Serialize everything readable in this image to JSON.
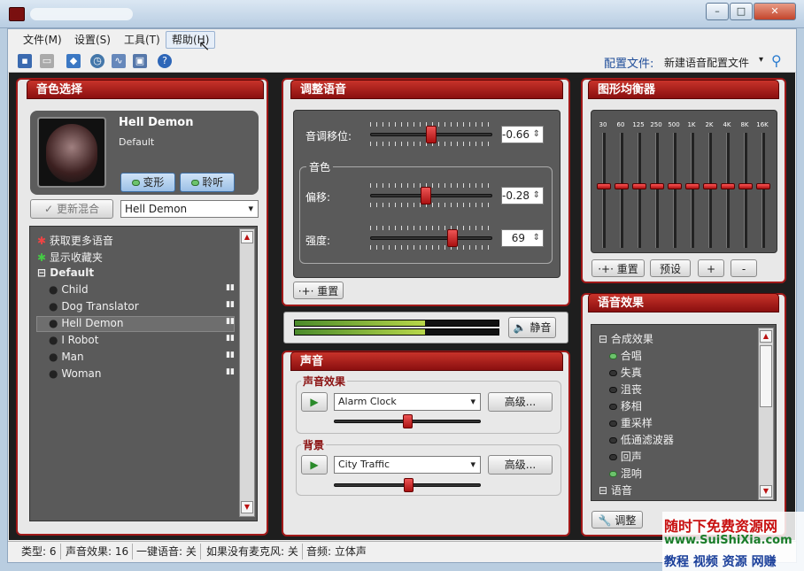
{
  "menu": {
    "file": "文件(M)",
    "settings": "设置(S)",
    "tools": "工具(T)",
    "help": "帮助(H)"
  },
  "toolbar": {
    "config_label": "配置文件:",
    "config_value": "新建语音配置文件"
  },
  "voice": {
    "title": "音色选择",
    "name": "Hell Demon",
    "preset": "Default",
    "morph": "变形",
    "listen": "聆听",
    "update": "更新混合",
    "selected": "Hell Demon",
    "tree": {
      "more": "获取更多语音",
      "fav": "显示收藏夹",
      "group": "Default",
      "items": [
        "Child",
        "Dog Translator",
        "Hell Demon",
        "I Robot",
        "Man",
        "Woman"
      ]
    }
  },
  "adjust": {
    "title": "调整语音",
    "pitch_label": "音调移位:",
    "pitch_value": "-0.66",
    "timbre": "音色",
    "offset_label": "偏移:",
    "offset_value": "-0.28",
    "strength_label": "强度:",
    "strength_value": "69",
    "reset": "重置",
    "pitch_level": 0.5,
    "offset_level": 0.45,
    "strength_level": 0.69
  },
  "meter": {
    "mute": "静音"
  },
  "sound": {
    "title": "声音",
    "effects_label": "声音效果",
    "effect_value": "Alarm Clock",
    "advanced1": "高级...",
    "bg_label": "背景",
    "bg_value": "City Traffic",
    "advanced2": "高级..."
  },
  "eq": {
    "title": "图形均衡器",
    "freqs": [
      "30",
      "60",
      "125",
      "250",
      "500",
      "1K",
      "2K",
      "4K",
      "8K",
      "16K"
    ],
    "reset": "重置",
    "preset": "预设",
    "plus": "+",
    "minus": "-"
  },
  "effects": {
    "title": "语音效果",
    "group": "合成效果",
    "items": [
      "合唱",
      "失真",
      "沮丧",
      "移相",
      "重采样",
      "低通滤波器",
      "回声",
      "混响"
    ],
    "group2": "语音",
    "adjust": "调整"
  },
  "status": {
    "type": "类型: 6",
    "sfx": "声音效果: 16",
    "oneclick": "一键语音: 关",
    "nomic": "如果没有麦克风: 关",
    "audio": "音频: 立体声"
  },
  "watermark": {
    "line1": "随时下免费资源网",
    "line2": "www.SuiShiXia.com",
    "line3": "教程 视频 资源 网赚"
  }
}
